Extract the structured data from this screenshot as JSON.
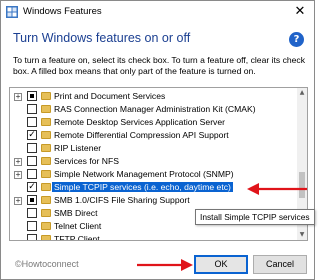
{
  "window": {
    "title": "Windows Features",
    "close_glyph": "✕"
  },
  "heading": "Turn Windows features on or off",
  "help_glyph": "?",
  "description": "To turn a feature on, select its check box. To turn a feature off, clear its check box. A filled box means that only part of the feature is turned on.",
  "features": [
    {
      "label": "Print and Document Services",
      "expander": "+",
      "state": "partial"
    },
    {
      "label": "RAS Connection Manager Administration Kit (CMAK)",
      "expander": "",
      "state": "off"
    },
    {
      "label": "Remote Desktop Services Application Server",
      "expander": "",
      "state": "off"
    },
    {
      "label": "Remote Differential Compression API Support",
      "expander": "",
      "state": "on"
    },
    {
      "label": "RIP Listener",
      "expander": "",
      "state": "off"
    },
    {
      "label": "Services for NFS",
      "expander": "+",
      "state": "off"
    },
    {
      "label": "Simple Network Management Protocol (SNMP)",
      "expander": "+",
      "state": "off"
    },
    {
      "label": "Simple TCPIP services (i.e. echo, daytime etc)",
      "expander": "",
      "state": "on"
    },
    {
      "label": "SMB 1.0/CIFS File Sharing Support",
      "expander": "+",
      "state": "partial"
    },
    {
      "label": "SMB Direct",
      "expander": "",
      "state": "off"
    },
    {
      "label": "Telnet Client",
      "expander": "",
      "state": "off"
    },
    {
      "label": "TFTP Client",
      "expander": "",
      "state": "off"
    }
  ],
  "check_glyph": "✓",
  "scroll": {
    "up_glyph": "▲",
    "down_glyph": "▼"
  },
  "tooltip": "Install Simple TCPIP services",
  "watermark": "©Howtoconnect",
  "buttons": {
    "ok": "OK",
    "cancel": "Cancel"
  },
  "colors": {
    "heading": "#1b3f91",
    "selection": "#0a63d1",
    "arrow": "#e0141a",
    "folder": "#e6bf57"
  }
}
